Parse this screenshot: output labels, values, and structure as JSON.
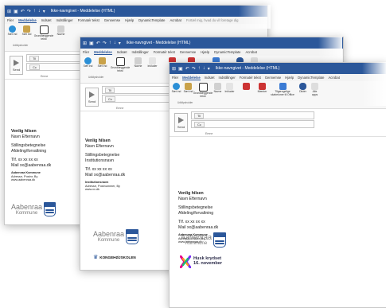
{
  "ribbon_tabs": [
    "Filer",
    "Meddelelse",
    "Indsæt",
    "Indstillinger",
    "Formatér tekst",
    "Gennemse",
    "Hjælp",
    "DynamicTemplate",
    "Acrobat"
  ],
  "search_hint": "Fortæl mig, hvad du vil foretage dig",
  "quick_access": [
    "↶",
    "↷",
    "↑",
    "↓",
    "▾"
  ],
  "title": "Ikke-navngivet - Meddelelse (HTML)",
  "ribbon_buttons": {
    "clipboard": "Sæt ind",
    "basic_text": "Grundlæggende tekst",
    "names": "Navne",
    "include": "Inkluder",
    "tags": "Mærker",
    "templates": "Tilgængelige skabeloner til Office",
    "dictate": "Diktér",
    "attach": "Alle apps",
    "clipboard_group": "Udklipsholder"
  },
  "compose": {
    "send_label": "Send",
    "to_label": "Til",
    "cc_label": "Cc",
    "subject_label": "Emne"
  },
  "signature1": {
    "greeting": "Venlig hilsen",
    "name": "Navn Efternavn",
    "title": "Stillingsbetegnelse",
    "dept": "Afdeling/forvaltning",
    "phone": "Tlf. xx xx xx xx",
    "mail": "Mail xx@aabenraa.dk",
    "org": "Aabenraa Kommune",
    "address": "Adresse, Postnr, By",
    "web": "www.aabenraa.dk",
    "logo_line1": "Aabenraa",
    "logo_line2": "Kommune"
  },
  "signature2": {
    "greeting": "Venlig hilsen",
    "name": "Navn Efternavn",
    "title": "Stillingsbetegnelse",
    "inst": "Institutionsnavn",
    "phone": "Tlf. xx xx xx xx",
    "mail": "Mail xx@aabenraa.dk",
    "org": "Institutionsnavn",
    "address": "Adresse, Postnummer, By",
    "web": "www.xx.dk",
    "logo_line1": "Aabenraa",
    "logo_line2": "Kommune",
    "school": "KONGEHØJSKOLEN"
  },
  "signature3": {
    "greeting": "Venlig hilsen",
    "name": "Navn Efternavn",
    "title": "Stillingsbetegnelse",
    "dept": "Afdeling/forvaltning",
    "phone": "Tlf. xx xx xx xx",
    "mail": "Mail xx@aabenraa.dk",
    "org": "Aabenraa Kommune",
    "address": "Adresse, Postnr, By",
    "web": "www.aabenraa.dk",
    "logo_line1": "Aabenraa",
    "logo_line2": "Kommune",
    "campaign1": "Husk krydset",
    "campaign2": "16. november"
  },
  "colors": {
    "title_bar": "#2b579a",
    "accent": "#2b579a",
    "logo_gray": "#7a7a7a"
  }
}
